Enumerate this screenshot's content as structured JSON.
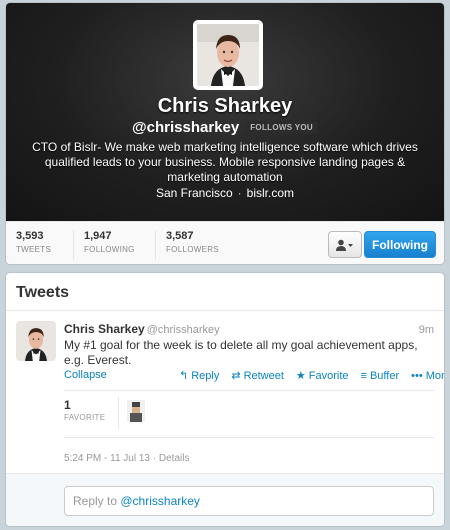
{
  "profile": {
    "name": "Chris Sharkey",
    "handle": "@chrissharkey",
    "follows_you": "FOLLOWS YOU",
    "bio": "CTO of Bislr- We make web marketing intelligence software which drives qualified leads to your business. Mobile responsive landing pages & marketing automation",
    "location": "San Francisco",
    "location_sep": "·",
    "website": "bislr.com",
    "stats": [
      {
        "value": "3,593",
        "label": "TWEETS"
      },
      {
        "value": "1,947",
        "label": "FOLLOWING"
      },
      {
        "value": "3,587",
        "label": "FOLLOWERS"
      }
    ],
    "follow_button": "Following",
    "user_menu_icon": "user-dropdown-icon"
  },
  "tweets_section": {
    "title": "Tweets",
    "tweet": {
      "name": "Chris Sharkey",
      "handle": "@chrissharkey",
      "time": "9m",
      "text": "My #1 goal for the week is to delete all my goal achievement apps, e.g. Everest.",
      "collapse": "Collapse",
      "actions": {
        "reply": "Reply",
        "retweet": "Retweet",
        "favorite": "Favorite",
        "buffer": "Buffer",
        "more": "More"
      },
      "favorites_count": "1",
      "favorites_label": "FAVORITE",
      "meta_time": "5:24 PM - 11 Jul 13",
      "meta_sep": "·",
      "details": "Details"
    },
    "reply": {
      "prefix": "Reply to",
      "handle": "@chrissharkey"
    }
  },
  "colors": {
    "accent": "#0a84c1",
    "follow_btn": "#1e8fdd",
    "header_bg": "#1f1f1f"
  }
}
